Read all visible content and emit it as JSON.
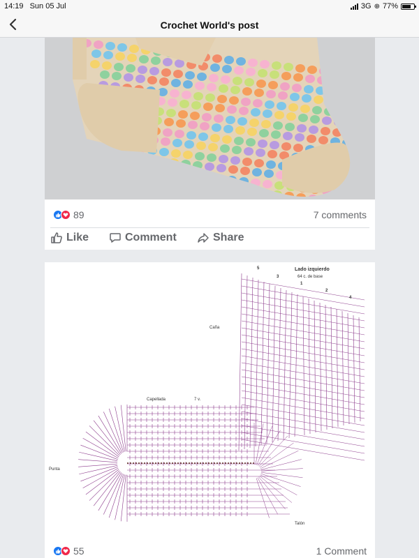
{
  "status": {
    "time": "14:19",
    "date": "Sun 05 Jul",
    "network": "3G",
    "battery": "77%",
    "battery_level": 0.77
  },
  "nav": {
    "title": "Crochet World's post",
    "back_icon": "chevron-left-icon"
  },
  "posts": [
    {
      "image": "crochet-sock-photo",
      "reaction_count": "89",
      "comments": "7 comments",
      "actions": {
        "like": "Like",
        "comment": "Comment",
        "share": "Share"
      }
    },
    {
      "image": "sock-crochet-chart",
      "chart_labels": {
        "lado": "Lado izquierdo",
        "base": "64 c. de base",
        "cana": "Caña",
        "capellada": "Capellada",
        "seven": "7 v.",
        "punta": "Punta",
        "talon": "Talón",
        "n1": "1",
        "n2": "2",
        "n3": "3",
        "n4": "4",
        "n5": "5"
      },
      "reaction_count": "55",
      "comments": "1 Comment"
    }
  ],
  "colors": {
    "accent": "#1877f2",
    "love": "#f0284a",
    "chart": "#8b3a8b"
  }
}
